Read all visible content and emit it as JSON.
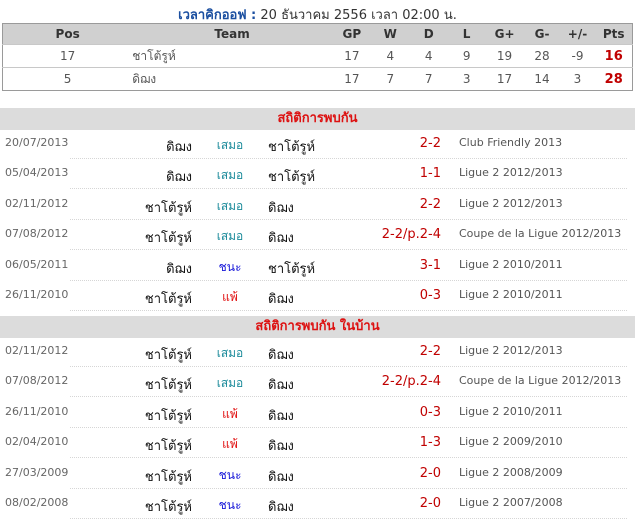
{
  "kickoff": {
    "label": "เวลาคิกออฟ :",
    "value": "20 ธันวาคม 2556 เวลา 02:00 น."
  },
  "standings": {
    "headers": [
      "Pos",
      "Team",
      "GP",
      "W",
      "D",
      "L",
      "G+",
      "G-",
      "+/-",
      "Pts"
    ],
    "rows": [
      {
        "pos": "17",
        "team": "ชาโต้รูห์",
        "gp": "17",
        "w": "4",
        "d": "4",
        "l": "9",
        "gf": "19",
        "ga": "28",
        "gd": "-9",
        "pts": "16"
      },
      {
        "pos": "5",
        "team": "ดิฌง",
        "gp": "17",
        "w": "7",
        "d": "7",
        "l": "3",
        "gf": "17",
        "ga": "14",
        "gd": "3",
        "pts": "28"
      }
    ]
  },
  "h2h": {
    "title": "สถิติการพบกัน",
    "matches": [
      {
        "date": "20/07/2013",
        "home": "ดิฌง",
        "result": "เสมอ",
        "result_type": "draw",
        "away": "ชาโต้รูห์",
        "score": "2-2",
        "competition": "Club Friendly 2013"
      },
      {
        "date": "05/04/2013",
        "home": "ดิฌง",
        "result": "เสมอ",
        "result_type": "draw",
        "away": "ชาโต้รูห์",
        "score": "1-1",
        "competition": "Ligue 2 2012/2013"
      },
      {
        "date": "02/11/2012",
        "home": "ชาโต้รูห์",
        "result": "เสมอ",
        "result_type": "draw",
        "away": "ดิฌง",
        "score": "2-2",
        "competition": "Ligue 2 2012/2013"
      },
      {
        "date": "07/08/2012",
        "home": "ชาโต้รูห์",
        "result": "เสมอ",
        "result_type": "draw",
        "away": "ดิฌง",
        "score": "2-2/p.2-4",
        "competition": "Coupe de la Ligue 2012/2013"
      },
      {
        "date": "06/05/2011",
        "home": "ดิฌง",
        "result": "ชนะ",
        "result_type": "win",
        "away": "ชาโต้รูห์",
        "score": "3-1",
        "competition": "Ligue 2 2010/2011"
      },
      {
        "date": "26/11/2010",
        "home": "ชาโต้รูห์",
        "result": "แพ้",
        "result_type": "loss",
        "away": "ดิฌง",
        "score": "0-3",
        "competition": "Ligue 2 2010/2011"
      }
    ]
  },
  "h2h_home": {
    "title": "สถิติการพบกัน ในบ้าน",
    "matches": [
      {
        "date": "02/11/2012",
        "home": "ชาโต้รูห์",
        "result": "เสมอ",
        "result_type": "draw",
        "away": "ดิฌง",
        "score": "2-2",
        "competition": "Ligue 2 2012/2013"
      },
      {
        "date": "07/08/2012",
        "home": "ชาโต้รูห์",
        "result": "เสมอ",
        "result_type": "draw",
        "away": "ดิฌง",
        "score": "2-2/p.2-4",
        "competition": "Coupe de la Ligue 2012/2013"
      },
      {
        "date": "26/11/2010",
        "home": "ชาโต้รูห์",
        "result": "แพ้",
        "result_type": "loss",
        "away": "ดิฌง",
        "score": "0-3",
        "competition": "Ligue 2 2010/2011"
      },
      {
        "date": "02/04/2010",
        "home": "ชาโต้รูห์",
        "result": "แพ้",
        "result_type": "loss",
        "away": "ดิฌง",
        "score": "1-3",
        "competition": "Ligue 2 2009/2010"
      },
      {
        "date": "27/03/2009",
        "home": "ชาโต้รูห์",
        "result": "ชนะ",
        "result_type": "win",
        "away": "ดิฌง",
        "score": "2-0",
        "competition": "Ligue 2 2008/2009"
      },
      {
        "date": "08/02/2008",
        "home": "ชาโต้รูห์",
        "result": "ชนะ",
        "result_type": "win",
        "away": "ดิฌง",
        "score": "2-0",
        "competition": "Ligue 2 2007/2008"
      }
    ]
  },
  "colors": {
    "draw": "#1a8a9a",
    "win": "#1515d8",
    "loss": "#e01010",
    "score": "#c00000",
    "section_title": "#dd1111",
    "kickoff_label": "#1b4fa0"
  }
}
